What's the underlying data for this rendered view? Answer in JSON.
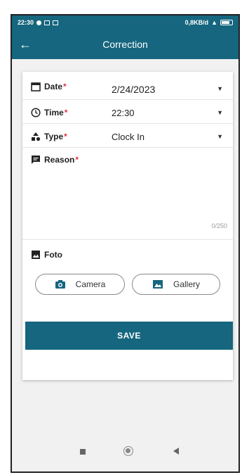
{
  "status_bar": {
    "time": "22:30",
    "network": "0,8KB/d"
  },
  "app_bar": {
    "title": "Correction",
    "back_icon": "arrow-left-icon"
  },
  "form": {
    "date": {
      "label": "Date",
      "required_mark": "*",
      "value": "2/24/2023",
      "icon": "calendar-icon"
    },
    "time": {
      "label": "Time",
      "required_mark": "*",
      "value": "22:30",
      "icon": "clock-icon"
    },
    "type": {
      "label": "Type",
      "required_mark": "*",
      "value": "Clock In",
      "icon": "shapes-icon"
    },
    "reason": {
      "label": "Reason",
      "required_mark": "*",
      "value": "",
      "counter": "0/250",
      "icon": "comment-icon"
    },
    "foto": {
      "label": "Foto",
      "icon": "image-icon"
    },
    "camera_button": {
      "label": "Camera",
      "icon": "camera-icon"
    },
    "gallery_button": {
      "label": "Gallery",
      "icon": "gallery-icon"
    },
    "save_button": {
      "label": "SAVE"
    }
  },
  "colors": {
    "primary": "#15667e",
    "required": "#e0334a"
  }
}
